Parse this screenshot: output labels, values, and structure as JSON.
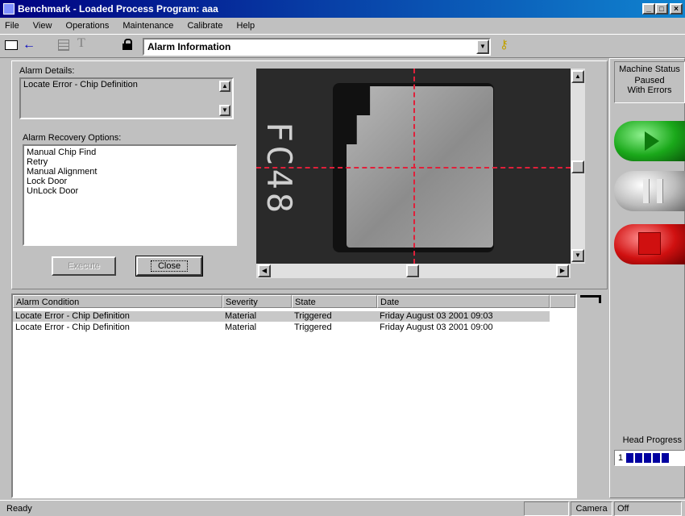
{
  "window": {
    "title": "Benchmark - Loaded Process Program: aaa",
    "title_buttons": [
      "_",
      "□",
      "×"
    ]
  },
  "menu": [
    "File",
    "View",
    "Operations",
    "Maintenance",
    "Calibrate",
    "Help"
  ],
  "toolbar": {
    "view_select_value": "Alarm Information",
    "icons": [
      "camera-icon",
      "back-arrow-icon",
      "grid-icon",
      "text-tool-icon",
      "lock-icon",
      "help-key-icon"
    ]
  },
  "alarm_details": {
    "label": "Alarm Details:",
    "text": "Locate Error - Chip Definition"
  },
  "recovery": {
    "label": "Alarm Recovery Options:",
    "options": [
      "Manual Chip Find",
      "Retry",
      "Manual Alignment",
      "Lock Door",
      "UnLock Door"
    ]
  },
  "buttons": {
    "execute": "Execute",
    "close": "Close"
  },
  "camera_image": {
    "chip_marking": "FC48"
  },
  "machine_status": {
    "label": "Machine Status",
    "value": "Paused With Errors",
    "controls": [
      "start-button",
      "pause-button",
      "stop-button"
    ]
  },
  "head_progress": {
    "label": "Head Progress",
    "number": "1",
    "segments_filled": 5,
    "segments_total": 5
  },
  "alarm_table": {
    "columns": [
      "Alarm Condition",
      "Severity",
      "State",
      "Date"
    ],
    "rows": [
      [
        "Locate Error - Chip Definition",
        "Material",
        "Triggered",
        "Friday August 03 2001 09:03"
      ],
      [
        "Locate Error - Chip Definition",
        "Material",
        "Triggered",
        "Friday August 03 2001 09:00"
      ]
    ]
  },
  "statusbar": {
    "text": "Ready",
    "camera": "Camera",
    "camera_state": "Off"
  },
  "colors": {
    "title_start": "#000080",
    "title_end": "#1084d0",
    "face": "#c0c0c0",
    "start_green": "#1aa81a",
    "stop_red": "#d01010",
    "crosshair": "#e0203a",
    "progress_blue": "#0000a0"
  }
}
